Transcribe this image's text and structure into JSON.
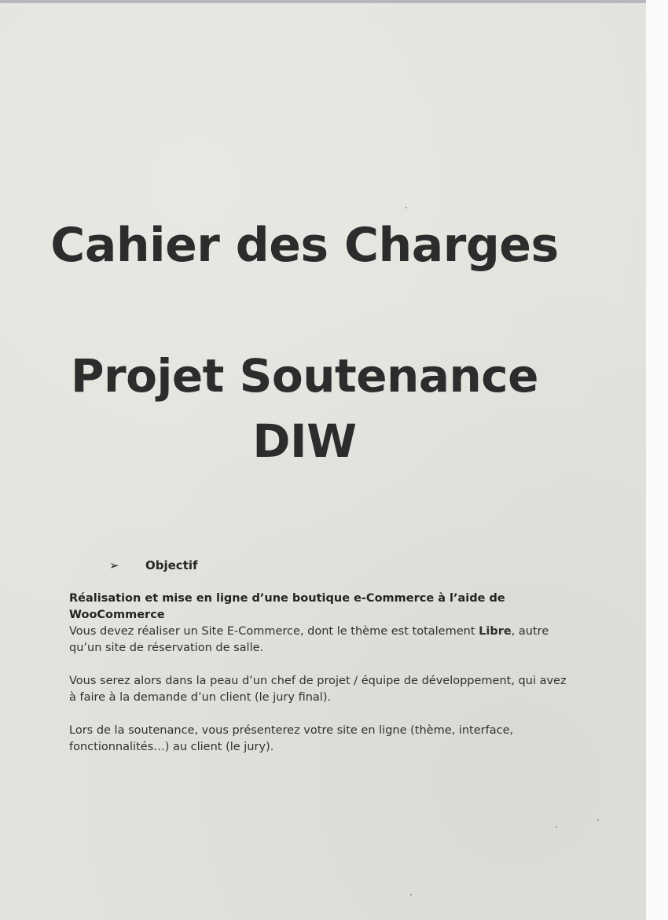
{
  "document": {
    "title": "Cahier des Charges",
    "subtitle_line1": "Projet Soutenance",
    "subtitle_line2": "DIW",
    "objective_bullet": "➢",
    "objective_label": "Objectif",
    "heading": "Réalisation et mise en ligne d’une boutique e-Commerce  à l’aide de WooCommerce",
    "p1_before_bold": "Vous devez réaliser un Site E-Commerce, dont le thème est totalement ",
    "p1_bold": "Libre",
    "p1_after_bold": ", autre qu’un site de réservation de salle.",
    "p2": "Vous serez alors dans la peau d’un chef de projet / équipe de développement, qui avez à faire à la demande d’un client (le jury final).",
    "p3": "Lors de la soutenance, vous présenterez votre site en ligne (thème, interface, fonctionnalités…) au client (le jury)."
  }
}
